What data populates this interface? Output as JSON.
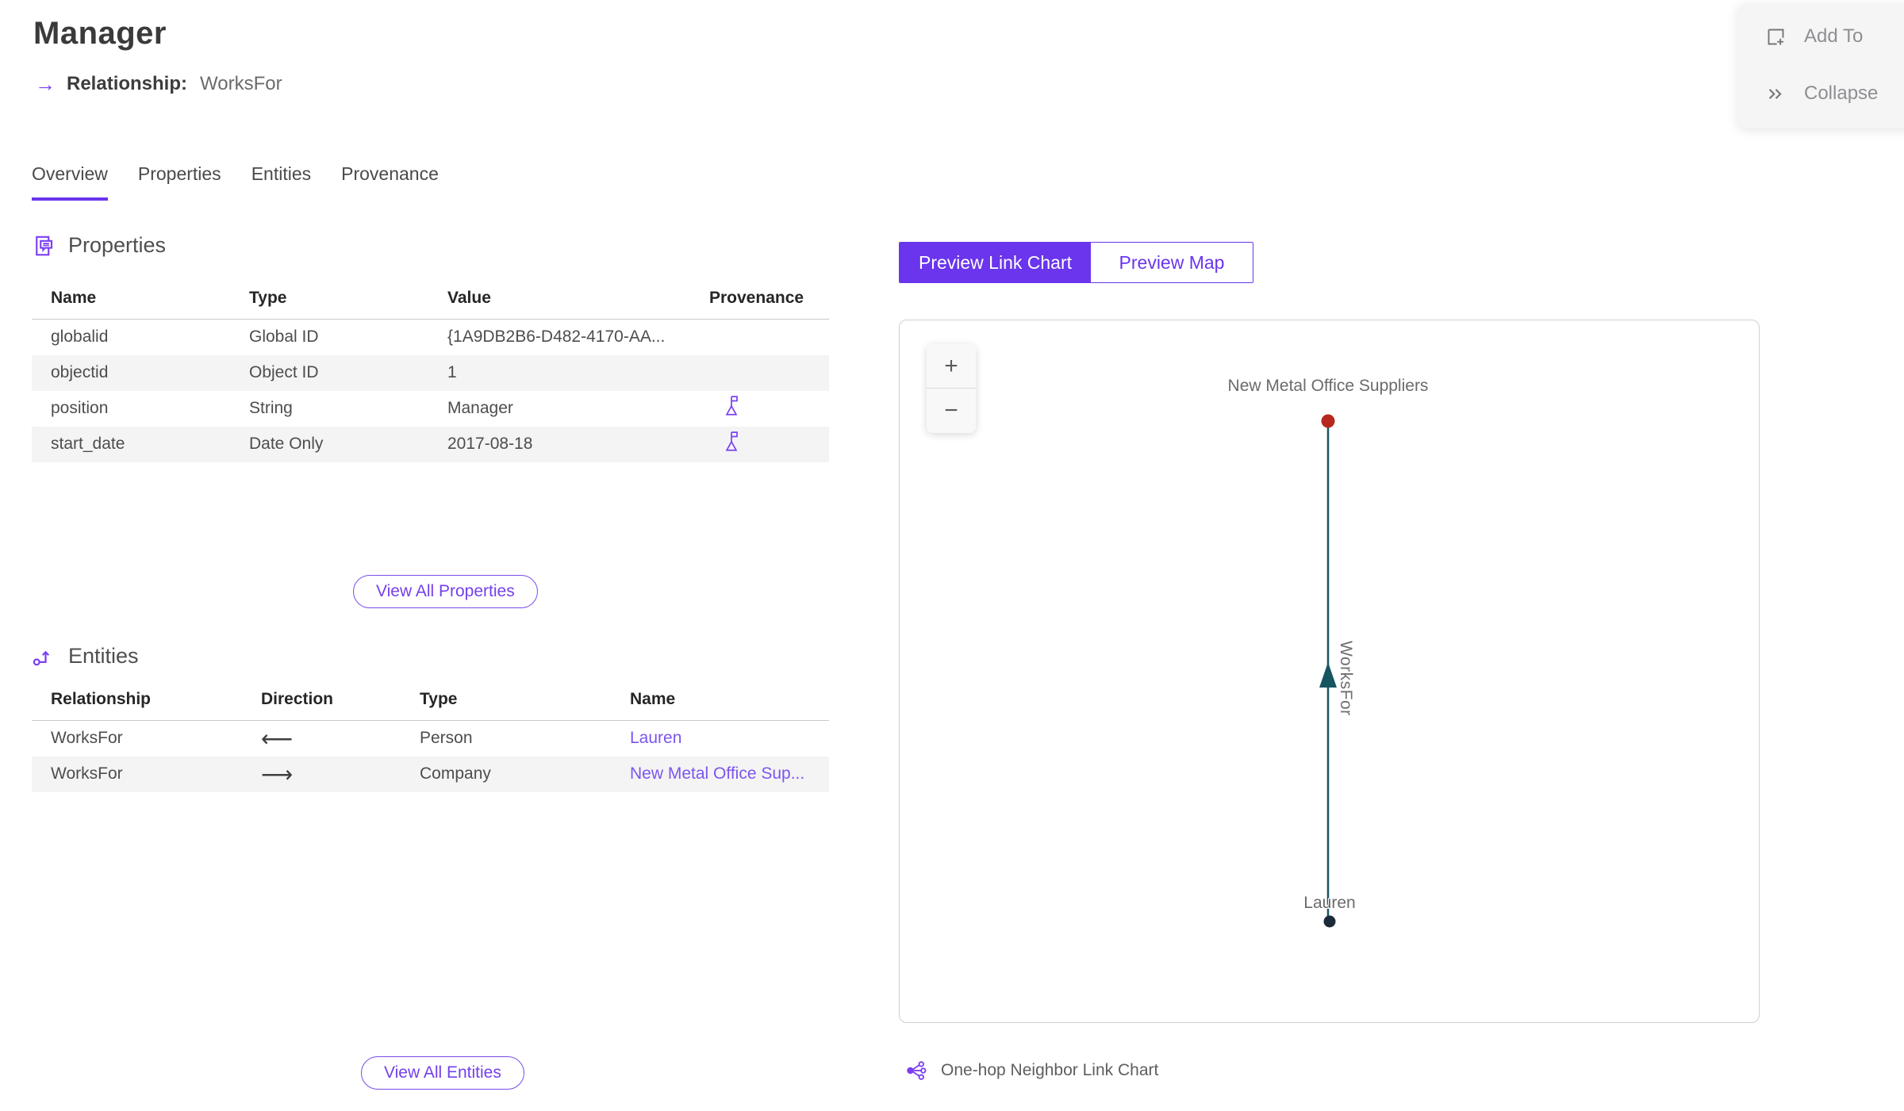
{
  "page": {
    "title": "Manager",
    "subtitle_arrow": "→",
    "subtitle_label": "Relationship:",
    "subtitle_value": "WorksFor"
  },
  "actions_panel": {
    "items": [
      {
        "label": "Add To",
        "icon": "add-to-icon"
      },
      {
        "label": "Collapse",
        "icon": "collapse-double-chevron-icon"
      }
    ]
  },
  "tabs": [
    {
      "label": "Overview",
      "active": true
    },
    {
      "label": "Properties",
      "active": false
    },
    {
      "label": "Entities",
      "active": false
    },
    {
      "label": "Provenance",
      "active": false
    }
  ],
  "properties_section": {
    "title": "Properties",
    "icon": "properties-icon",
    "columns": [
      "Name",
      "Type",
      "Value",
      "Provenance"
    ],
    "rows": [
      {
        "name": "globalid",
        "type": "Global ID",
        "value": "{1A9DB2B6-D482-4170-AA...",
        "has_provenance": false
      },
      {
        "name": "objectid",
        "type": "Object ID",
        "value": "1",
        "has_provenance": false
      },
      {
        "name": "position",
        "type": "String",
        "value": "Manager",
        "has_provenance": true
      },
      {
        "name": "start_date",
        "type": "Date Only",
        "value": "2017-08-18",
        "has_provenance": true
      }
    ],
    "view_all": "View All Properties"
  },
  "entities_section": {
    "title": "Entities",
    "icon": "entities-icon",
    "columns": [
      "Relationship",
      "Direction",
      "Type",
      "Name"
    ],
    "rows": [
      {
        "relationship": "WorksFor",
        "direction": "incoming",
        "direction_glyph": "⟵",
        "type": "Person",
        "name": "Lauren"
      },
      {
        "relationship": "WorksFor",
        "direction": "outgoing",
        "direction_glyph": "⟶",
        "type": "Company",
        "name": "New Metal Office Sup..."
      }
    ],
    "view_all": "View All Entities"
  },
  "preview": {
    "toggle": [
      {
        "label": "Preview Link Chart",
        "active": true
      },
      {
        "label": "Preview Map",
        "active": false
      }
    ],
    "zoom_in_label": "+",
    "zoom_out_label": "−",
    "caption": "One-hop Neighbor Link Chart"
  },
  "chart_data": {
    "type": "link-chart",
    "nodes": [
      {
        "id": "company",
        "label": "New Metal Office Suppliers",
        "color": "#b7271d"
      },
      {
        "id": "person",
        "label": "Lauren",
        "color": "#1c2b39"
      }
    ],
    "edges": [
      {
        "from": "person",
        "to": "company",
        "label": "WorksFor",
        "color": "#175661",
        "arrow": "up"
      }
    ]
  },
  "colors": {
    "accent_purple": "#6a35ec",
    "link_purple": "#7c55ee",
    "row_alt_gray": "#f4f4f4",
    "node_red": "#b7271d",
    "node_navy": "#1c2b39",
    "edge_teal": "#175661"
  }
}
